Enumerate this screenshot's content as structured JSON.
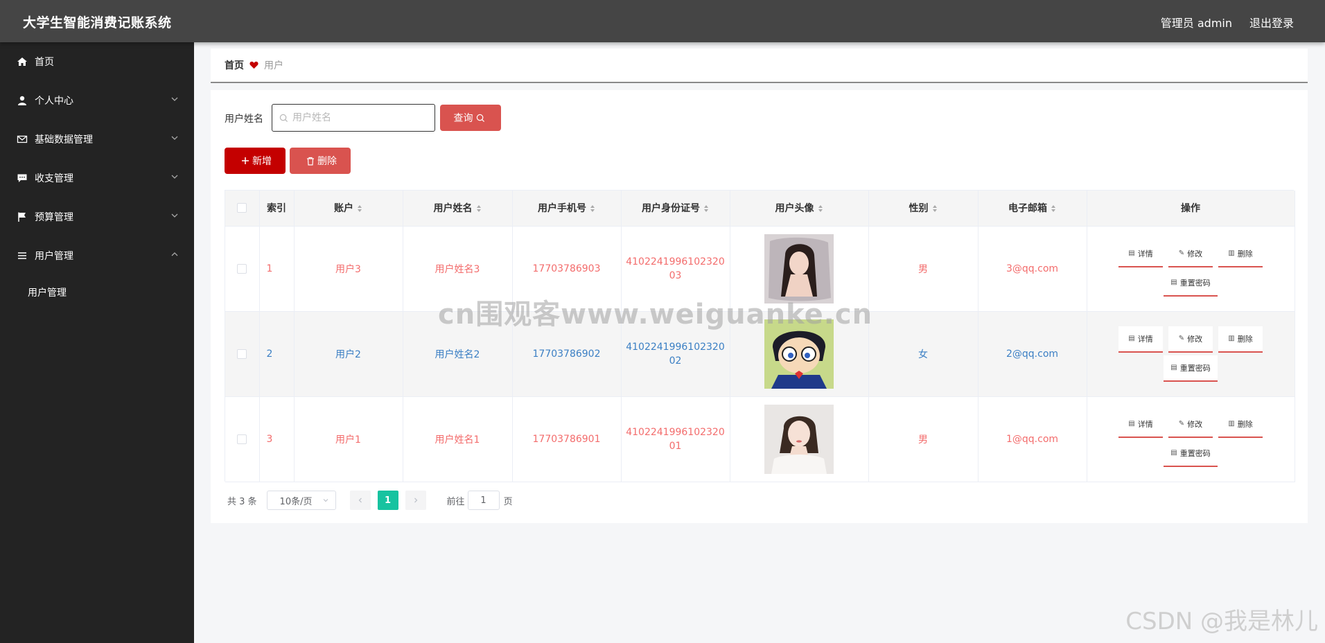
{
  "header": {
    "app_title": "大学生智能消费记账系统",
    "admin_label": "管理员 admin",
    "logout_label": "退出登录"
  },
  "sidebar": {
    "items": [
      {
        "label": "首页",
        "icon": "home-icon"
      },
      {
        "label": "个人中心",
        "icon": "user-icon"
      },
      {
        "label": "基础数据管理",
        "icon": "mail-icon"
      },
      {
        "label": "收支管理",
        "icon": "chat-icon"
      },
      {
        "label": "预算管理",
        "icon": "flag-icon"
      },
      {
        "label": "用户管理",
        "icon": "menu-icon"
      }
    ],
    "submenu": {
      "label": "用户管理"
    }
  },
  "breadcrumb": {
    "home": "首页",
    "current": "用户"
  },
  "search": {
    "label": "用户姓名",
    "placeholder": "用户姓名",
    "query_label": "查询"
  },
  "actions": {
    "add_label": "新增",
    "delete_label": "删除"
  },
  "table": {
    "headers": [
      "索引",
      "账户",
      "用户姓名",
      "用户手机号",
      "用户身份证号",
      "用户头像",
      "性别",
      "电子邮箱",
      "操作"
    ],
    "rows": [
      {
        "index": "1",
        "account": "用户3",
        "name": "用户姓名3",
        "phone": "17703786903",
        "id_line1": "4102241996102320",
        "id_line2": "03",
        "gender": "男",
        "email": "3@qq.com"
      },
      {
        "index": "2",
        "account": "用户2",
        "name": "用户姓名2",
        "phone": "17703786902",
        "id_line1": "4102241996102320",
        "id_line2": "02",
        "gender": "女",
        "email": "2@qq.com"
      },
      {
        "index": "3",
        "account": "用户1",
        "name": "用户姓名1",
        "phone": "17703786901",
        "id_line1": "4102241996102320",
        "id_line2": "01",
        "gender": "男",
        "email": "1@qq.com"
      }
    ],
    "ops": {
      "detail": "详情",
      "edit": "修改",
      "delete": "删除",
      "reset": "重置密码"
    }
  },
  "pagination": {
    "total": "共 3 条",
    "page_size": "10条/页",
    "current_page": "1",
    "goto_label": "前往",
    "goto_value": "1",
    "page_suffix": "页"
  },
  "watermarks": {
    "center": "cn围观客www.weiguanke.cn",
    "corner": "CSDN @我是林儿"
  },
  "colors": {
    "accent": "#d9534f",
    "add_button": "#c40000",
    "active_page": "#17c3a0",
    "odd_row_text": "#f36c6c",
    "even_row_text": "#3b7fc4"
  }
}
